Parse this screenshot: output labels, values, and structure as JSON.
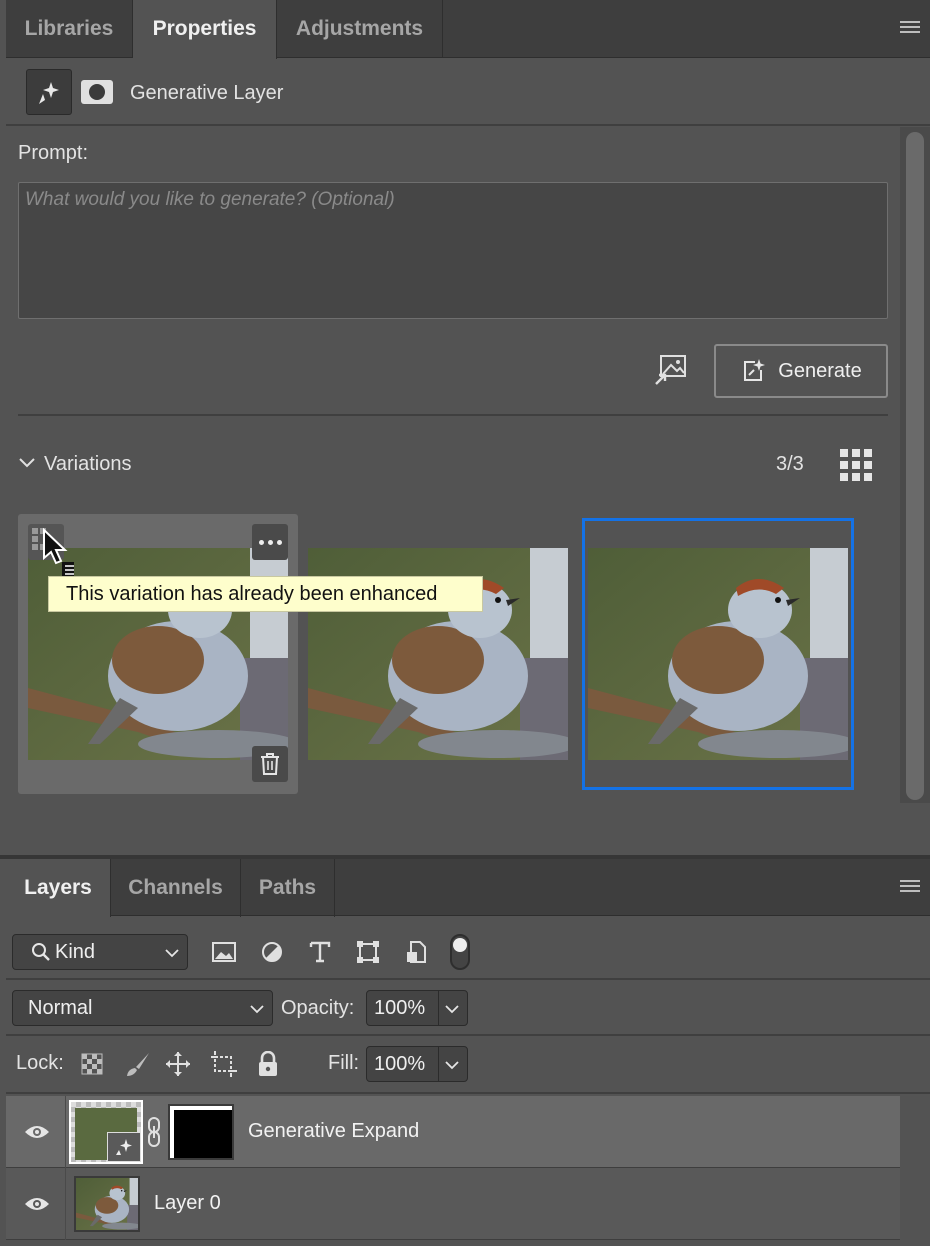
{
  "properties_panel": {
    "tabs": [
      "Libraries",
      "Properties",
      "Adjustments"
    ],
    "layer_type_label": "Generative Layer",
    "prompt_label": "Prompt:",
    "prompt_placeholder": "What would you like to generate? (Optional)",
    "prompt_value": "",
    "generate_label": "Generate",
    "variations_label": "Variations",
    "variations_count": "3/3",
    "tooltip": "This variation has already been enhanced"
  },
  "layers_panel": {
    "tabs": [
      "Layers",
      "Channels",
      "Paths"
    ],
    "filter_kind": "Kind",
    "blend_mode": "Normal",
    "opacity_label": "Opacity:",
    "opacity_value": "100%",
    "lock_label": "Lock:",
    "fill_label": "Fill:",
    "fill_value": "100%",
    "layers": [
      {
        "name": "Generative Expand"
      },
      {
        "name": "Layer 0"
      }
    ]
  },
  "colors": {
    "accent": "#1472e6",
    "panel_bg": "#535353",
    "tab_bar_bg": "#3e3e3e",
    "tooltip_bg": "#fefecc"
  }
}
